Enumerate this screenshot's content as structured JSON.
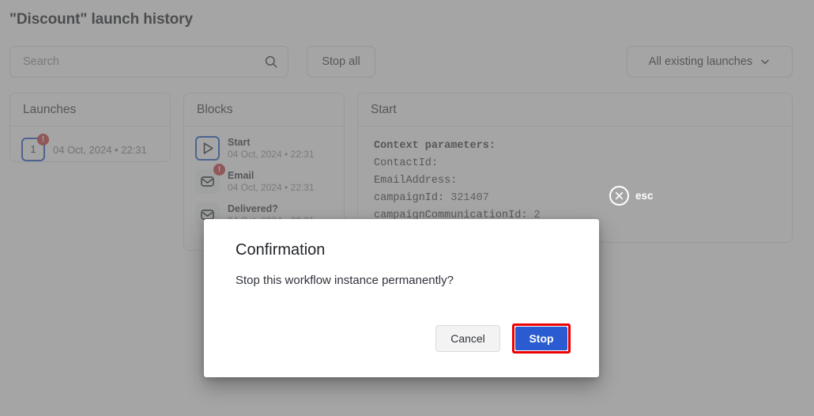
{
  "page": {
    "title": "\"Discount\" launch history"
  },
  "toolbar": {
    "search": {
      "placeholder": "Search",
      "value": "",
      "icon": "search-icon"
    },
    "stop_all_label": "Stop all",
    "launch_filter": {
      "label": "All existing launches",
      "icon": "chevron-down-icon"
    }
  },
  "launches_panel": {
    "header": "Launches",
    "rows": [
      {
        "number": "1",
        "badge": "!",
        "date": "04 Oct, 2024 • 22:31"
      }
    ]
  },
  "blocks_panel": {
    "header": "Blocks",
    "items": [
      {
        "title": "Start",
        "date": "04 Oct, 2024 • 22:31",
        "icon": "play-icon",
        "selected": true,
        "badge": ""
      },
      {
        "title": "Email",
        "date": "04 Oct, 2024 • 22:31",
        "icon": "envelope-icon",
        "selected": false,
        "badge": "!"
      },
      {
        "title": "Delivered?",
        "date": "04 Oct, 2024 • 22:31",
        "icon": "envelope-icon",
        "selected": false,
        "badge": ""
      }
    ]
  },
  "start_panel": {
    "header": "Start",
    "code": {
      "heading": "Context parameters:",
      "lines": [
        {
          "key": "ContactId:",
          "value": ""
        },
        {
          "key": "EmailAddress:",
          "value": ""
        },
        {
          "key": "campaignId:",
          "value": "321407"
        },
        {
          "key": "campaignCommunicationId:",
          "value": "2"
        }
      ]
    }
  },
  "esc_close": {
    "label": "esc",
    "icon": "close-circle-icon"
  },
  "modal": {
    "title": "Confirmation",
    "message": "Stop this workflow instance permanently?",
    "cancel_label": "Cancel",
    "stop_label": "Stop"
  },
  "colors": {
    "accent_blue": "#1a56c4",
    "primary_button": "#2a5bd0",
    "highlight_red": "#ef0000",
    "badge_red": "#c93636",
    "dim_overlay": "#6e6e6e"
  }
}
